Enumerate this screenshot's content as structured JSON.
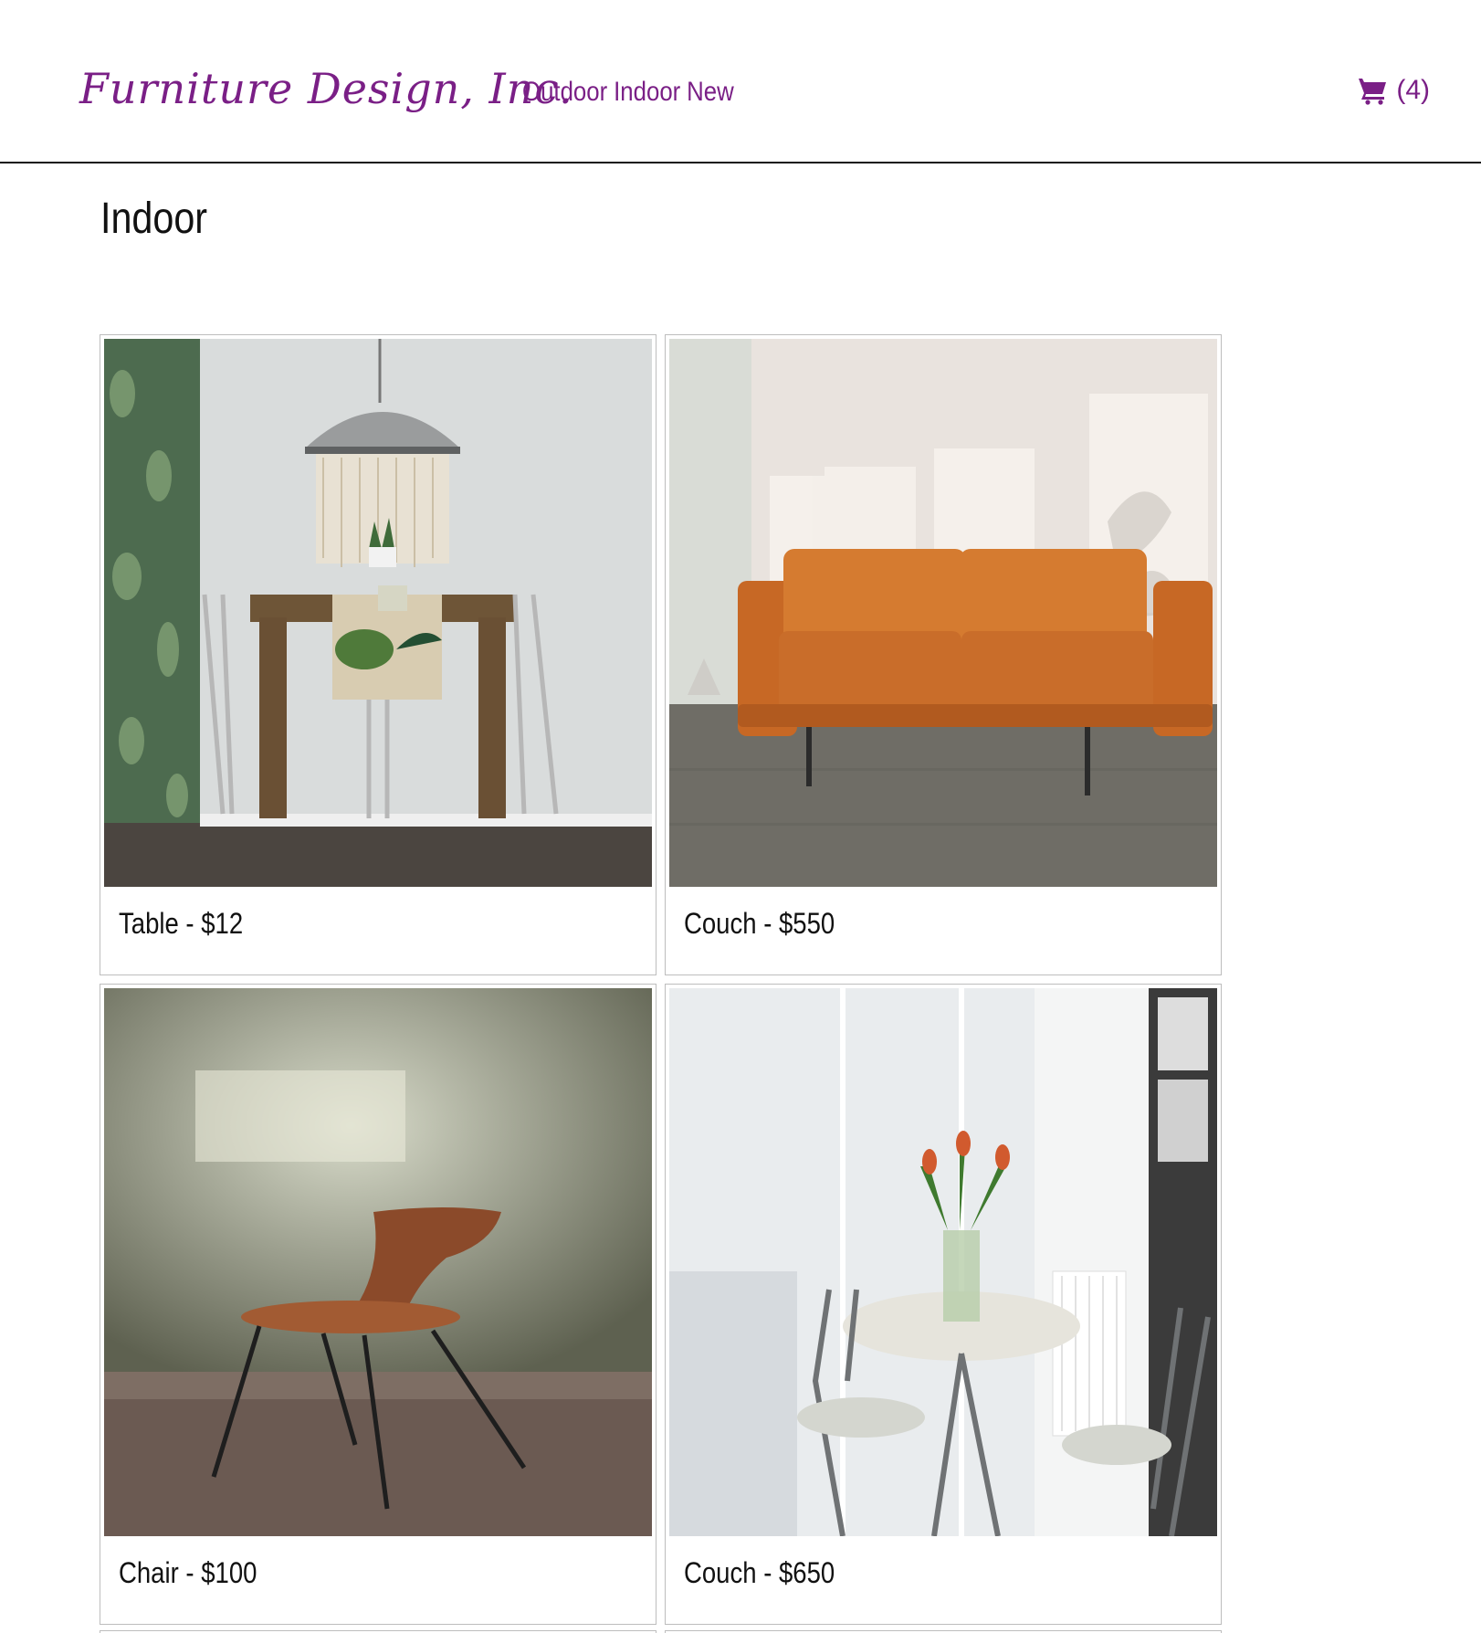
{
  "header": {
    "logo_text": "Furniture Design, Inc.",
    "nav": [
      "Outdoor",
      "Indoor",
      "New"
    ],
    "cart_count": "(4)"
  },
  "page": {
    "title": "Indoor"
  },
  "products": [
    {
      "caption": "Table - $12",
      "image": "dining-table-photo"
    },
    {
      "caption": "Couch - $550",
      "image": "orange-leather-couch-photo"
    },
    {
      "caption": "Chair - $100",
      "image": "wooden-chair-photo"
    },
    {
      "caption": "Couch - $650",
      "image": "bistro-table-photo"
    }
  ],
  "colors": {
    "brand": "#7a1f86",
    "text": "#111111",
    "card_border": "#bdbdbd"
  },
  "icons": {
    "cart": "shopping-cart-icon"
  }
}
